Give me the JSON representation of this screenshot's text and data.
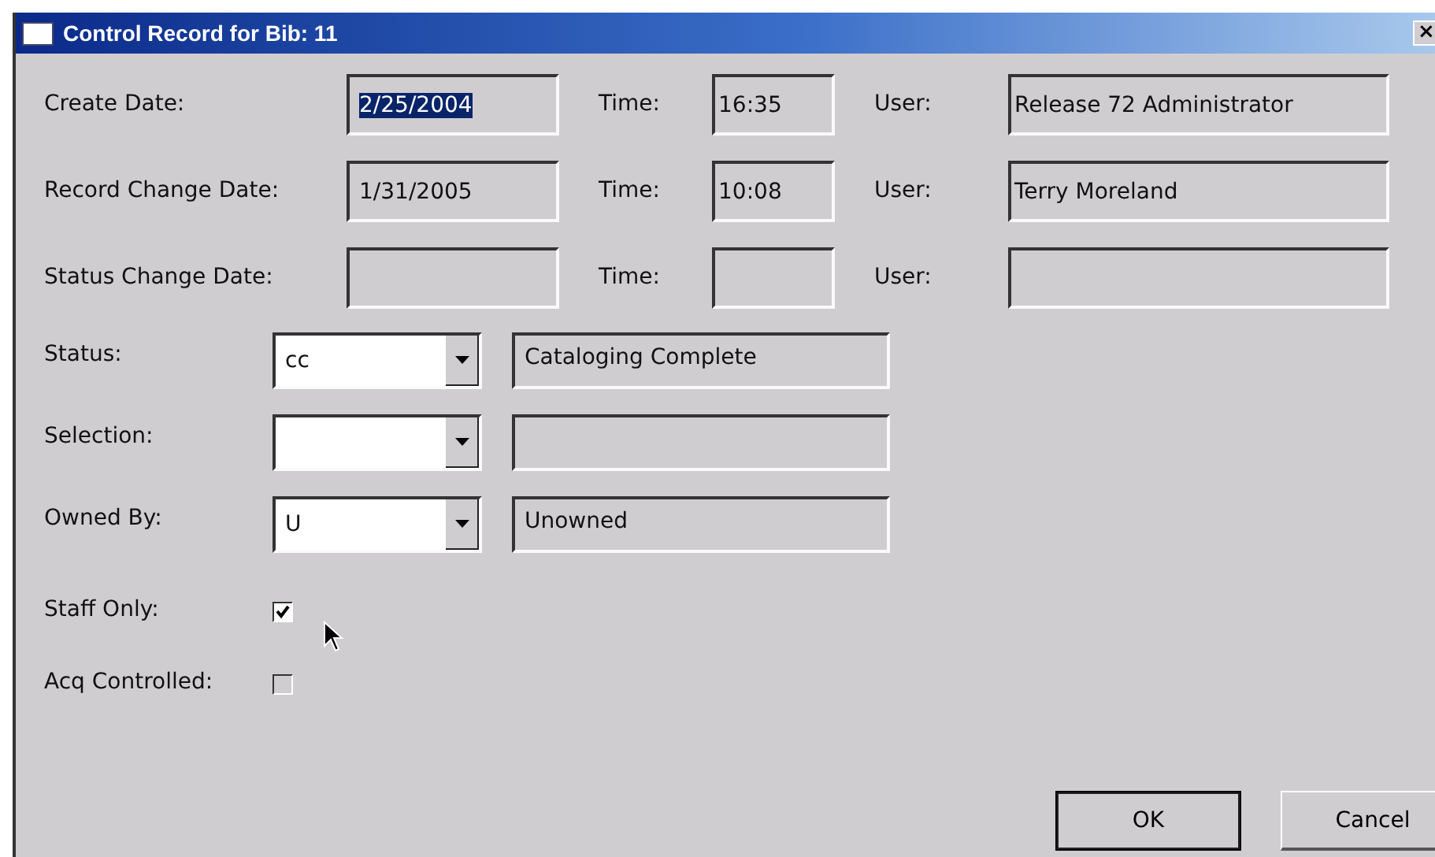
{
  "window": {
    "title": "Control Record for Bib: 11",
    "close": "×"
  },
  "dates": [
    {
      "label": "Create Date:",
      "date": "2/25/2004",
      "date_text_selected": true,
      "time_label": "Time:",
      "time": "16:35",
      "user_label": "User:",
      "user": "Release 72 Administrator"
    },
    {
      "label": "Record Change Date:",
      "date": "1/31/2005",
      "date_text_selected": false,
      "time_label": "Time:",
      "time": "10:08",
      "user_label": "User:",
      "user": "Terry Moreland"
    },
    {
      "label": "Status Change Date:",
      "time_label": "Time:",
      "user_label": "User:"
    }
  ],
  "codes": [
    {
      "label": "Status:",
      "value": "cc",
      "description": "Cataloging Complete"
    },
    {
      "label": "Selection:"
    },
    {
      "label": "Owned By:",
      "value": "U",
      "description": "Unowned"
    }
  ],
  "checkboxes": [
    {
      "label": "Staff Only:",
      "checked": true
    },
    {
      "label": "Acq Controlled:",
      "checked": false
    }
  ],
  "buttons": [
    {
      "label": "OK",
      "default": true
    },
    {
      "label": "Cancel",
      "default": false
    }
  ]
}
